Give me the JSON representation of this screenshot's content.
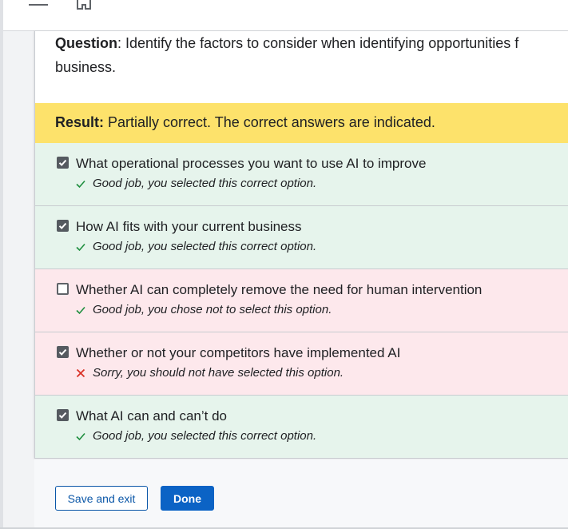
{
  "question": {
    "label": "Question",
    "text_line1": ": Identify the factors to consider when identifying opportunities f",
    "text_line2": "business."
  },
  "result": {
    "label": "Result:",
    "text": " Partially correct. The correct answers are indicated."
  },
  "options": [
    {
      "label": "What operational processes you want to use AI to improve",
      "checked": true,
      "status": "correct",
      "feedback": "Good job, you selected this correct option.",
      "feedback_icon": "check-icon"
    },
    {
      "label": "How AI fits with your current business",
      "checked": true,
      "status": "correct",
      "feedback": "Good job, you selected this correct option.",
      "feedback_icon": "check-icon"
    },
    {
      "label": "Whether AI can completely remove the need for human intervention",
      "checked": false,
      "status": "incorrect",
      "feedback": "Good job, you chose not to select this option.",
      "feedback_icon": "check-icon"
    },
    {
      "label": "Whether or not your competitors have implemented AI",
      "checked": true,
      "status": "incorrect",
      "feedback": "Sorry, you should not have selected this option.",
      "feedback_icon": "cross-icon"
    },
    {
      "label": "What AI can and can’t do",
      "checked": true,
      "status": "correct",
      "feedback": "Good job, you selected this correct option.",
      "feedback_icon": "check-icon"
    }
  ],
  "footer": {
    "save_label": "Save and exit",
    "done_label": "Done"
  },
  "colors": {
    "correct_bg": "#e6f4ec",
    "incorrect_bg": "#fde8ec",
    "result_bg": "#fde26b",
    "check_green": "#1e8e3e",
    "cross_red": "#d93025",
    "primary_blue": "#0b63c5"
  }
}
